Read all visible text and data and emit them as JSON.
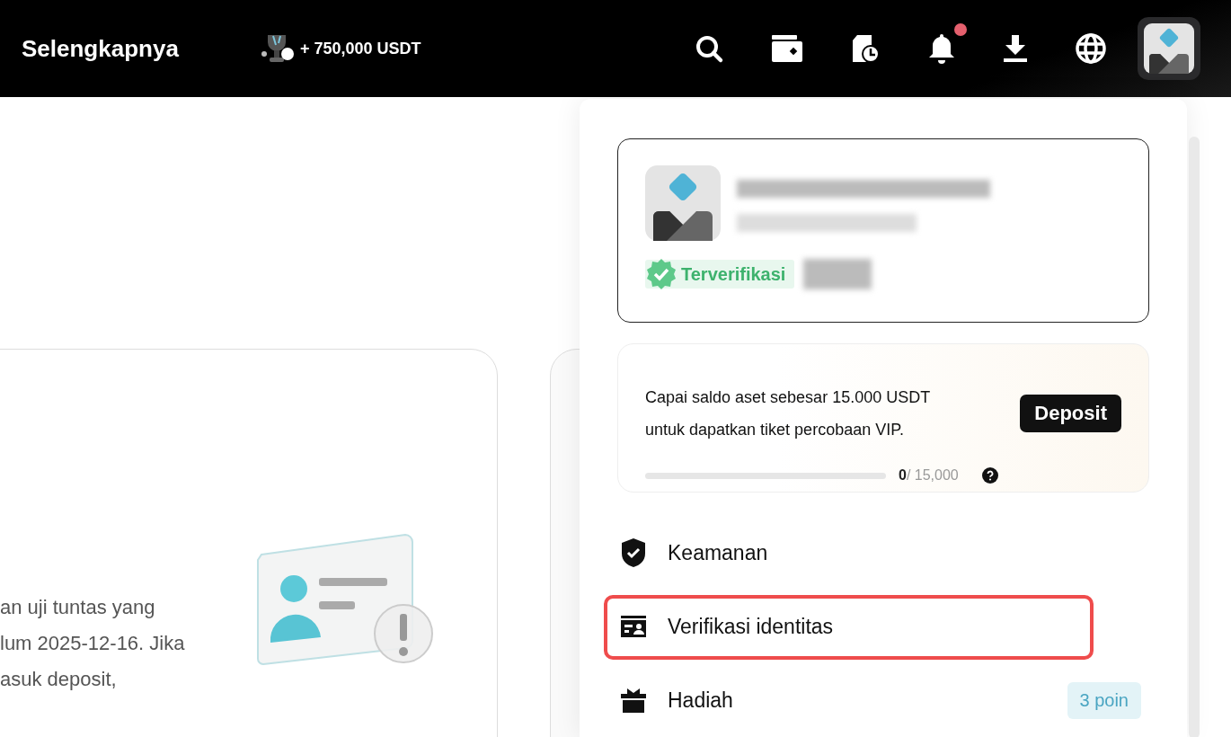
{
  "header": {
    "title": "Selengkapnya",
    "reward": "+ 750,000 USDT",
    "actions": [
      {
        "unread": false
      },
      {
        "unread": false
      },
      {
        "unread": false
      },
      {
        "unread": true
      },
      {
        "unread": false
      },
      {
        "unread": false
      }
    ]
  },
  "notice_card": {
    "lines": [
      "an uji tuntas yang",
      "lum 2025-12-16. Jika",
      "asuk deposit,"
    ]
  },
  "account_menu": {
    "profile": {
      "verified": true,
      "badge": "Terverifikasi"
    },
    "promo": {
      "text": "Capai saldo aset sebesar 15.000 USDT untuk dapatkan tiket percobaan VIP.",
      "button": "Deposit",
      "level": 0,
      "current": "0",
      "target": "/ 15,000"
    },
    "items": [
      {
        "label": "Keamanan",
        "highlighted": false
      },
      {
        "label": "Verifikasi identitas",
        "highlighted": true
      },
      {
        "label": "Hadiah",
        "highlighted": false,
        "badge": "3 poin"
      }
    ]
  }
}
